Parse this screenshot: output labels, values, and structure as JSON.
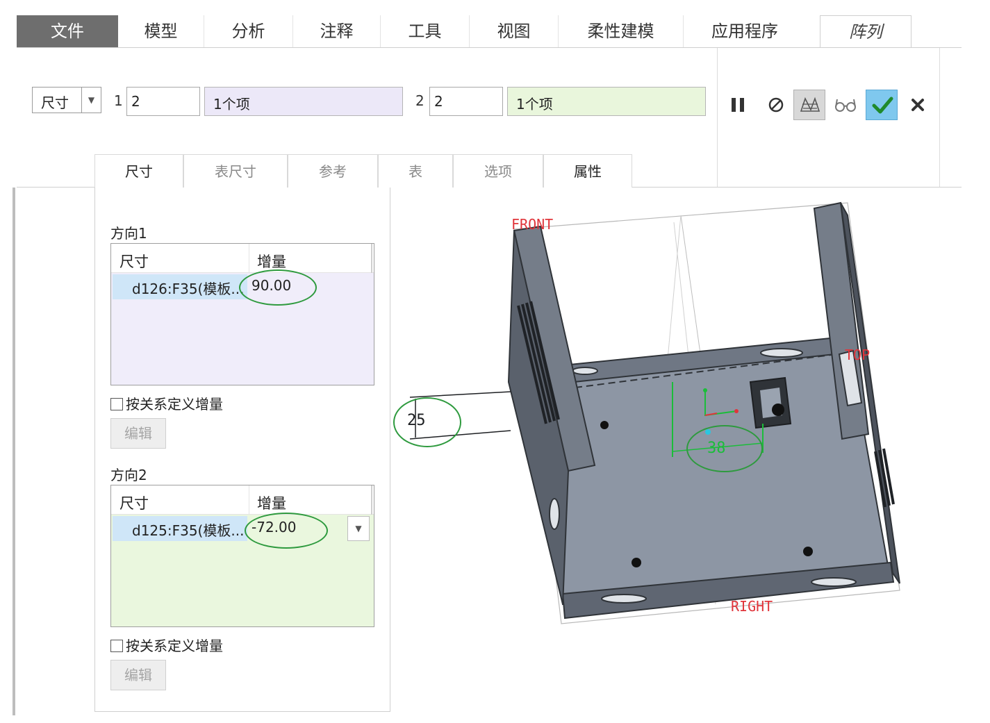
{
  "menu": {
    "tabs": [
      {
        "label": "文件"
      },
      {
        "label": "模型"
      },
      {
        "label": "分析"
      },
      {
        "label": "注释"
      },
      {
        "label": "工具"
      },
      {
        "label": "视图"
      },
      {
        "label": "柔性建模"
      },
      {
        "label": "应用程序"
      },
      {
        "label": "阵列"
      }
    ]
  },
  "ribbon": {
    "pattern_type": "尺寸",
    "dir1": {
      "index": "1",
      "count": "2",
      "items": "1个项"
    },
    "dir2": {
      "index": "2",
      "count": "2",
      "items": "1个项"
    },
    "buttons": [
      "pause-icon",
      "no-preview-icon",
      "preview-icon",
      "glasses-icon",
      "confirm-icon",
      "cancel-icon"
    ]
  },
  "subtabs": [
    {
      "label": "尺寸",
      "enabled": true
    },
    {
      "label": "表尺寸",
      "enabled": false
    },
    {
      "label": "参考",
      "enabled": false
    },
    {
      "label": "表",
      "enabled": false
    },
    {
      "label": "选项",
      "enabled": false
    },
    {
      "label": "属性",
      "enabled": true
    }
  ],
  "panel": {
    "direction1": {
      "title": "方向1",
      "col_dim": "尺寸",
      "col_inc": "增量",
      "rows": [
        {
          "dim": "d126:F35(模板...",
          "inc": "90.00"
        }
      ],
      "relation_label": "按关系定义增量",
      "edit_label": "编辑"
    },
    "direction2": {
      "title": "方向2",
      "col_dim": "尺寸",
      "col_inc": "增量",
      "rows": [
        {
          "dim": "d125:F35(模板...",
          "inc": "-72.00"
        }
      ],
      "relation_label": "按关系定义增量",
      "edit_label": "编辑"
    }
  },
  "viewport": {
    "datum_front": "FRONT",
    "datum_top": "TOP",
    "datum_right": "RIGHT",
    "dim_vertical": "25",
    "dim_horizontal": "38"
  },
  "colors": {
    "highlight_green": "#2e9a3e",
    "datum_red": "#e0353b",
    "part_fill": "#8d96a4",
    "part_dark": "#3a3d42"
  }
}
